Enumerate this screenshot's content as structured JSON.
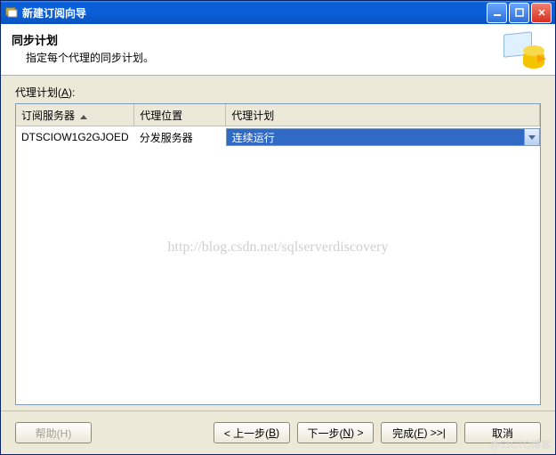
{
  "window": {
    "title": "新建订阅向导"
  },
  "header": {
    "title": "同步计划",
    "subtitle": "指定每个代理的同步计划。"
  },
  "section": {
    "label_pre": "代理计划(",
    "label_key": "A",
    "label_post": "):"
  },
  "table": {
    "columns": {
      "c0": "订阅服务器",
      "c1": "代理位置",
      "c2": "代理计划"
    },
    "rows": [
      {
        "server": "DTSCIOW1G2GJOED",
        "location": "分发服务器",
        "schedule": "连续运行"
      }
    ]
  },
  "watermarks": {
    "center": "http://blog.csdn.net/sqlserverdiscovery",
    "corner": "@51CTO博客"
  },
  "buttons": {
    "help": "帮助(H)",
    "back_pre": "< 上一步(",
    "back_key": "B",
    "back_post": ")",
    "next_pre": "下一步(",
    "next_key": "N",
    "next_post": ") >",
    "finish_pre": "完成(",
    "finish_key": "F",
    "finish_post": ") >>|",
    "cancel": "取消"
  }
}
